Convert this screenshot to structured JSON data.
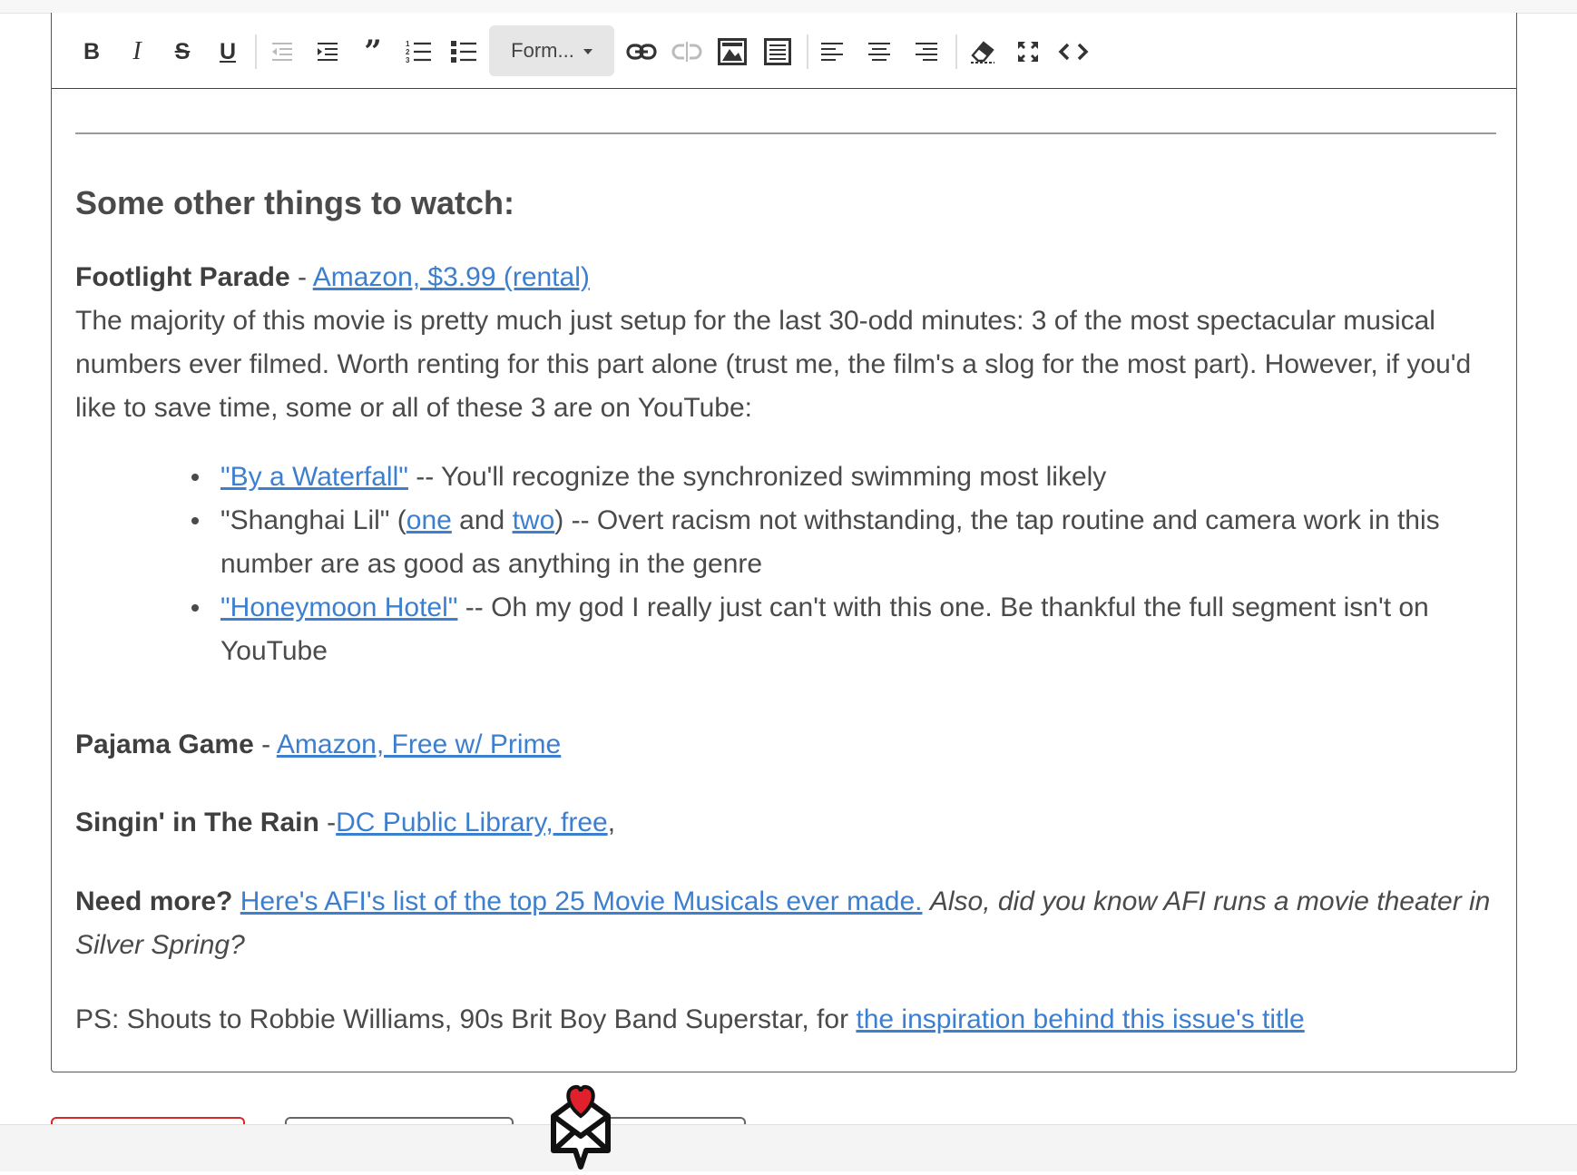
{
  "toolbar": {
    "format_label": "Form...",
    "buttons": [
      "bold-icon",
      "italic-icon",
      "strikethrough-icon",
      "underline-icon",
      "outdent-icon",
      "indent-icon",
      "blockquote-icon",
      "ordered-list-icon",
      "unordered-list-icon",
      "link-icon",
      "unlink-icon",
      "image-icon",
      "table-icon",
      "align-left-icon",
      "align-center-icon",
      "align-right-icon",
      "eraser-icon",
      "fullscreen-icon",
      "code-icon"
    ]
  },
  "content": {
    "heading": "Some other things to watch:",
    "footlight": {
      "title": "Footlight Parade",
      "sep": " - ",
      "link": "Amazon, $3.99 (rental)",
      "body": "The majority of this movie is pretty much just setup for the last 30-odd minutes: 3 of the most spectacular musical numbers ever filmed. Worth renting for this part alone (trust me, the film's a slog for the most part). However, if you'd like to save time, some or all of these 3 are on YouTube:"
    },
    "bullets": {
      "b1_link": "\"By a Waterfall\"",
      "b1_text": " -- You'll recognize the synchronized swimming most likely",
      "b2_pre": "\"Shanghai Lil\" (",
      "b2_link1": "one",
      "b2_mid": " and ",
      "b2_link2": "two",
      "b2_text": ") -- Overt racism not withstanding, the tap routine and camera work in this number are as good as anything in the genre",
      "b3_link": "\"Honeymoon Hotel\"",
      "b3_text": " -- Oh my god I really just can't with this one. Be thankful the full segment isn't on YouTube"
    },
    "pajama": {
      "title": "Pajama Game",
      "sep": " - ",
      "link": "Amazon, Free w/ Prime"
    },
    "singin": {
      "title": "Singin' in The Rain",
      "sep": " -",
      "link": "DC Public Library, free",
      "after": ","
    },
    "need_more": {
      "title": "Need more?",
      "link": "Here's AFI's list of the top 25 Movie Musicals ever made.",
      "italic": "Also, did you know AFI runs a movie theater in Silver Spring?"
    },
    "ps": {
      "text": "PS: Shouts to Robbie Williams, 90s Brit Boy Band Superstar, for ",
      "link": "the inspiration behind this issue's title"
    }
  },
  "colors": {
    "link": "#3d7fcf",
    "text": "#4a4a4a",
    "accent_red": "#d32a2a",
    "heart": "#e0202a"
  }
}
